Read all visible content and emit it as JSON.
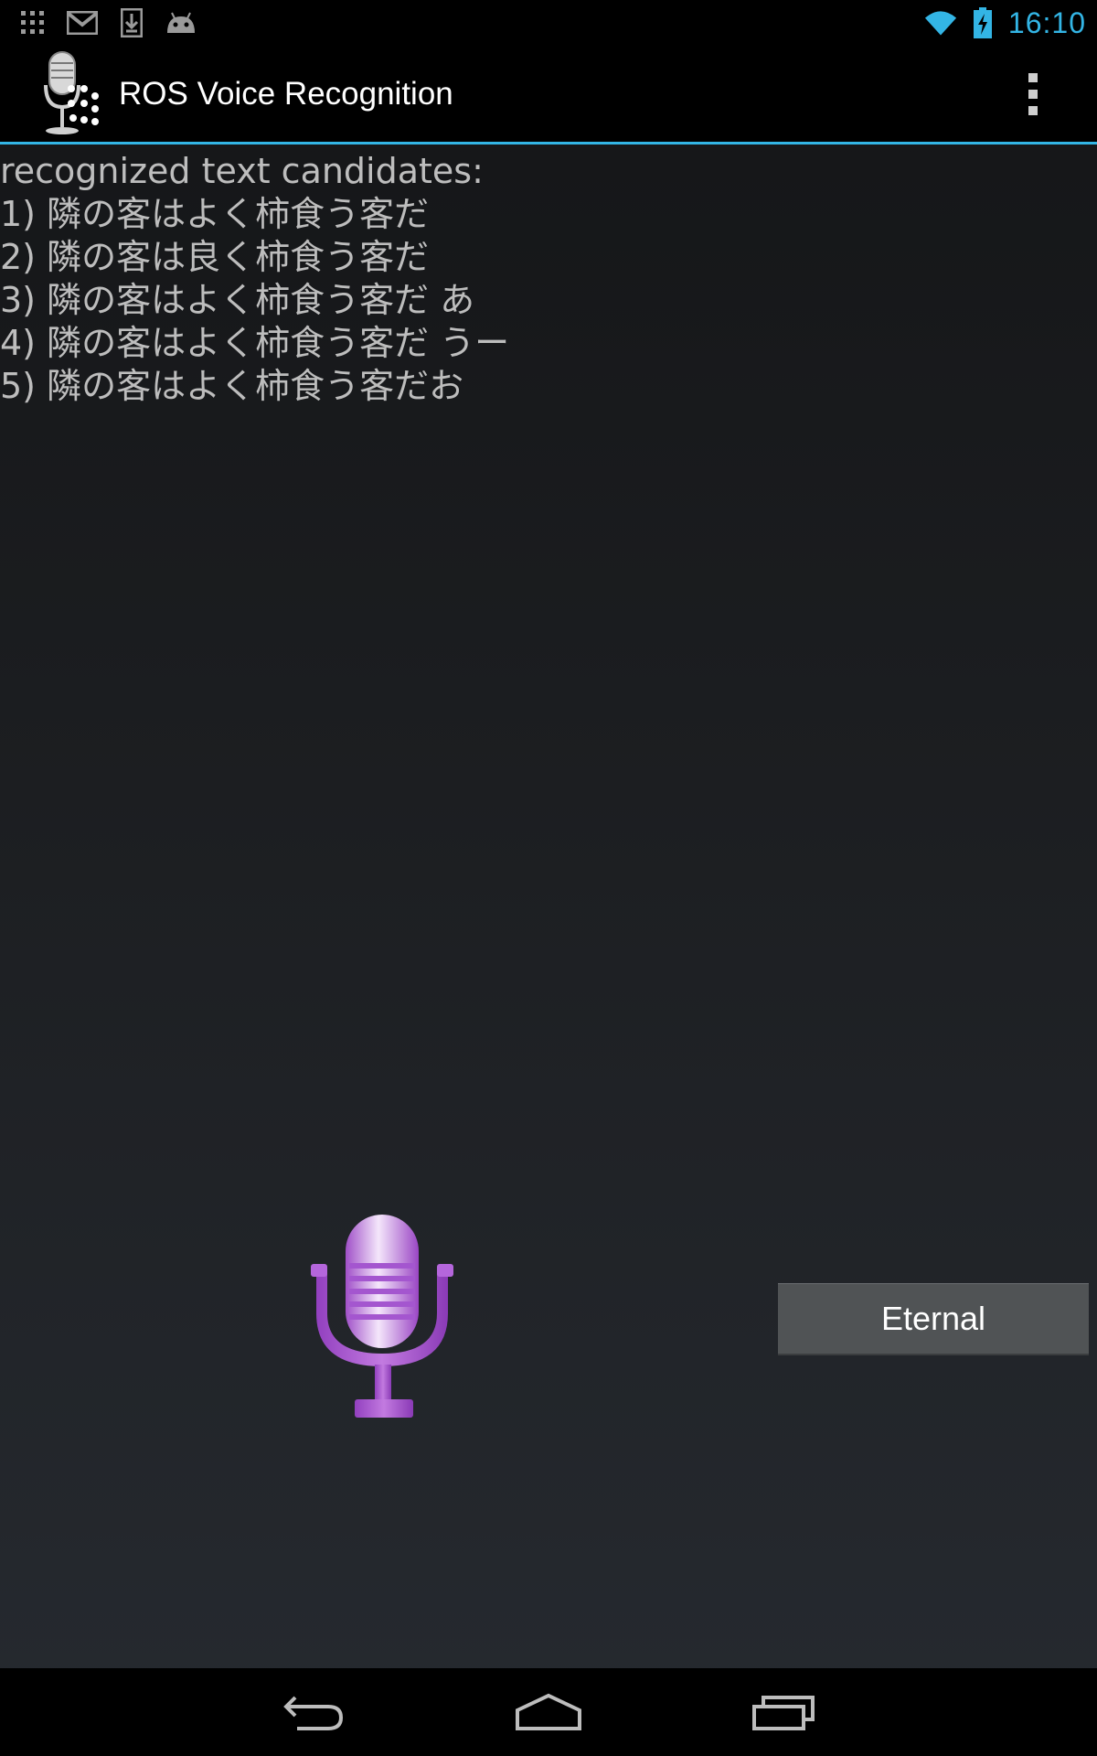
{
  "status_bar": {
    "time": "16:10",
    "accent_color": "#33b5e5",
    "left_icons": [
      "apps-grid-icon",
      "gmail-icon",
      "download-icon",
      "android-icon"
    ],
    "right_icons": [
      "wifi-icon",
      "battery-charging-icon"
    ]
  },
  "action_bar": {
    "title": "ROS Voice Recognition",
    "icon": "microphone-app-icon",
    "overflow_icon": "overflow-menu-icon"
  },
  "results": {
    "header": "recognized text candidates:",
    "candidates": [
      "1) 隣の客はよく柿食う客だ",
      "2) 隣の客は良く柿食う客だ",
      "3) 隣の客はよく柿食う客だ あ",
      "4) 隣の客はよく柿食う客だ うー",
      "5) 隣の客はよく柿食う客だお"
    ]
  },
  "mic": {
    "icon": "microphone-icon",
    "color": "#b15ad6"
  },
  "eternal_button": {
    "label": "Eternal"
  },
  "nav_bar": {
    "icons": [
      "back-icon",
      "home-icon",
      "recent-apps-icon"
    ]
  }
}
